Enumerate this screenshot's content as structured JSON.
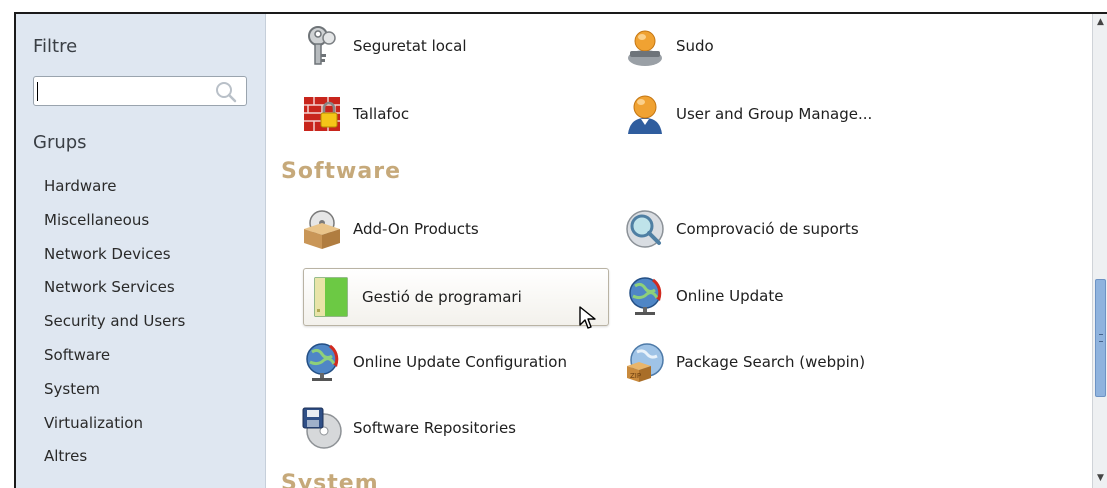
{
  "sidebar": {
    "filter_heading": "Filtre",
    "search_placeholder": "",
    "groups_heading": "Grups",
    "groups": [
      "Hardware",
      "Miscellaneous",
      "Network Devices",
      "Network Services",
      "Security and Users",
      "Software",
      "System",
      "Virtualization",
      "Altres"
    ]
  },
  "security": {
    "items": [
      {
        "label": "Seguretat local",
        "icon": "keys-icon"
      },
      {
        "label": "Sudo",
        "icon": "sudo-user-icon"
      },
      {
        "label": "Tallafoc",
        "icon": "firewall-icon"
      },
      {
        "label": "User and Group Manage...",
        "icon": "user-icon"
      }
    ]
  },
  "software": {
    "heading": "Software",
    "items": [
      {
        "label": "Add-On Products",
        "icon": "addon-box-icon"
      },
      {
        "label": "Comprovació de suports",
        "icon": "media-check-icon"
      },
      {
        "label": "Gestió de programari",
        "icon": "software-management-icon"
      },
      {
        "label": "Online Update",
        "icon": "online-update-icon"
      },
      {
        "label": "Online Update Configuration",
        "icon": "online-update-config-icon"
      },
      {
        "label": "Package Search (webpin)",
        "icon": "package-search-icon"
      },
      {
        "label": "Software Repositories",
        "icon": "repositories-icon"
      }
    ]
  },
  "system": {
    "heading": "System"
  },
  "colors": {
    "sidebar_bg": "#dfe7f1",
    "section_heading": "#c6a97a",
    "scroll_thumb": "#8fb3de"
  }
}
